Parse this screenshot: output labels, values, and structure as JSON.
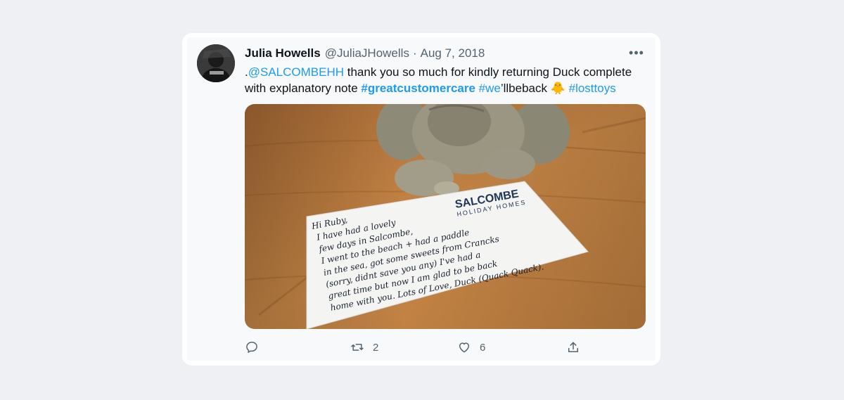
{
  "tweet": {
    "author_name": "Julia Howells",
    "handle": "@JuliaJHowells",
    "separator": "·",
    "date": "Aug 7, 2018",
    "text": {
      "prefix": ".",
      "mention": "@SALCOMBEHH",
      "body": " thank you so much for kindly returning Duck complete with explanatory note ",
      "hashtag1": "#greatcustomercare",
      "space1": " ",
      "hashtag2": "#we",
      "after_hashtag2": "’llbeback ",
      "emoji": "🐥",
      "space2": " ",
      "hashtag3": "#losttoys"
    },
    "media": {
      "card_brand_line1": "SALCOMBE",
      "card_brand_line2": "HOLIDAY HOMES",
      "note_lines": [
        "Hi Ruby,",
        "I have had a lovely",
        "few days in Salcombe,",
        "I went to the beach + had a paddle",
        "in the sea, got some sweets from Crancks",
        "(sorry, didnt save you any) I've had a",
        "great time but now I am glad to be back",
        "home with you. Lots of Love, Duck (Quack Quack)."
      ]
    },
    "actions": {
      "reply_count": "",
      "retweet_count": "2",
      "like_count": "6"
    }
  }
}
